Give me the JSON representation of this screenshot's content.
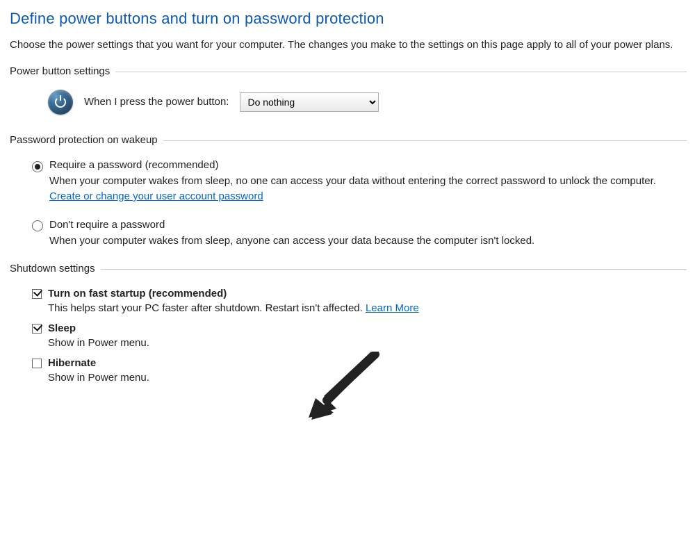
{
  "title": "Define power buttons and turn on password protection",
  "intro": "Choose the power settings that you want for your computer. The changes you make to the settings on this page apply to all of your power plans.",
  "sections": {
    "power_button": {
      "heading": "Power button settings",
      "label": "When I press the power button:",
      "selected": "Do nothing"
    },
    "wakeup": {
      "heading": "Password protection on wakeup",
      "require": {
        "title": "Require a password (recommended)",
        "desc_pre": "When your computer wakes from sleep, no one can access your data without entering the correct password to unlock the computer. ",
        "link": "Create or change your user account password"
      },
      "noreq": {
        "title": "Don't require a password",
        "desc": "When your computer wakes from sleep, anyone can access your data because the computer isn't locked."
      }
    },
    "shutdown": {
      "heading": "Shutdown settings",
      "fast": {
        "title": "Turn on fast startup (recommended)",
        "desc_pre": "This helps start your PC faster after shutdown. Restart isn't affected. ",
        "link": "Learn More"
      },
      "sleep": {
        "title": "Sleep",
        "desc": "Show in Power menu."
      },
      "hibernate": {
        "title": "Hibernate",
        "desc": "Show in Power menu."
      }
    }
  }
}
